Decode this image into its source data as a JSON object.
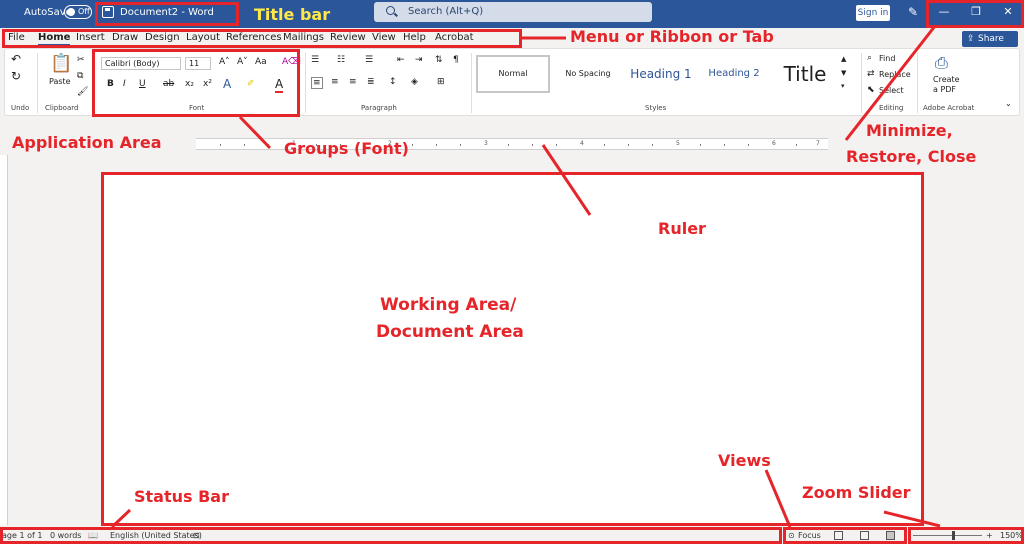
{
  "titlebar": {
    "autosave_label": "AutoSave",
    "autosave_state": "Off",
    "document_title": "Document2  -  Word",
    "search_placeholder": "Search (Alt+Q)",
    "signin_label": "Sign in"
  },
  "tabs": [
    "File",
    "Home",
    "Insert",
    "Draw",
    "Design",
    "Layout",
    "References",
    "Mailings",
    "Review",
    "View",
    "Help",
    "Acrobat"
  ],
  "share_label": "Share",
  "ribbon": {
    "undo_label": "Undo",
    "clipboard": {
      "paste_label": "Paste",
      "group_label": "Clipboard"
    },
    "font": {
      "font_name": "Calibri (Body)",
      "font_size": "11",
      "group_label": "Font"
    },
    "paragraph_label": "Paragraph",
    "styles": {
      "items": [
        "Normal",
        "No Spacing",
        "Heading 1",
        "Heading 2",
        "Title"
      ],
      "group_label": "Styles"
    },
    "editing": {
      "find_label": "Find",
      "replace_label": "Replace",
      "select_label": "Select",
      "group_label": "Editing"
    },
    "acrobat": {
      "create_label": "Create",
      "pdf_label": "a PDF",
      "group_label": "Adobe Acrobat"
    }
  },
  "ruler_numbers": [
    "1",
    "2",
    "3",
    "4",
    "5",
    "6",
    "7"
  ],
  "statusbar": {
    "page_info": "age 1 of 1",
    "word_count": "0 words",
    "language": "English (United States)",
    "focus_label": "Focus",
    "zoom_level": "150%"
  },
  "annotations": {
    "title_bar": "Title bar",
    "menu": "Menu or Ribbon or Tab",
    "application_area": "Application Area",
    "groups": "Groups (Font)",
    "minimize_line1": "Minimize,",
    "minimize_line2": "Restore, Close",
    "ruler": "Ruler",
    "working_area_line1": "Working Area/",
    "working_area_line2": "Document Area",
    "views": "Views",
    "status_bar": "Status Bar",
    "zoom_slider": "Zoom Slider"
  },
  "colors": {
    "title_bar": "#2b579a",
    "annotation": "#e5252a",
    "title_annotation": "#ffe84a"
  }
}
